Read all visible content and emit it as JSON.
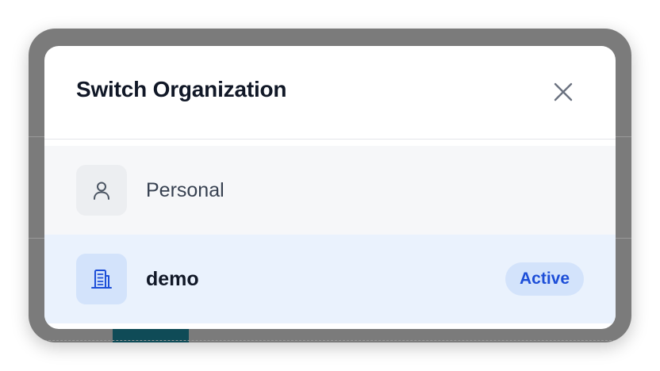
{
  "dialog": {
    "title": "Switch Organization",
    "close_icon": "close-icon"
  },
  "organizations": [
    {
      "name": "Personal",
      "icon": "user-icon",
      "active": false
    },
    {
      "name": "demo",
      "icon": "building-icon",
      "active": true,
      "badge": "Active"
    }
  ],
  "colors": {
    "active_background": "#eaf2fd",
    "accent": "#1d4ed8",
    "badge_background": "#d3e3fb",
    "overlay": "#7b7b7b"
  }
}
